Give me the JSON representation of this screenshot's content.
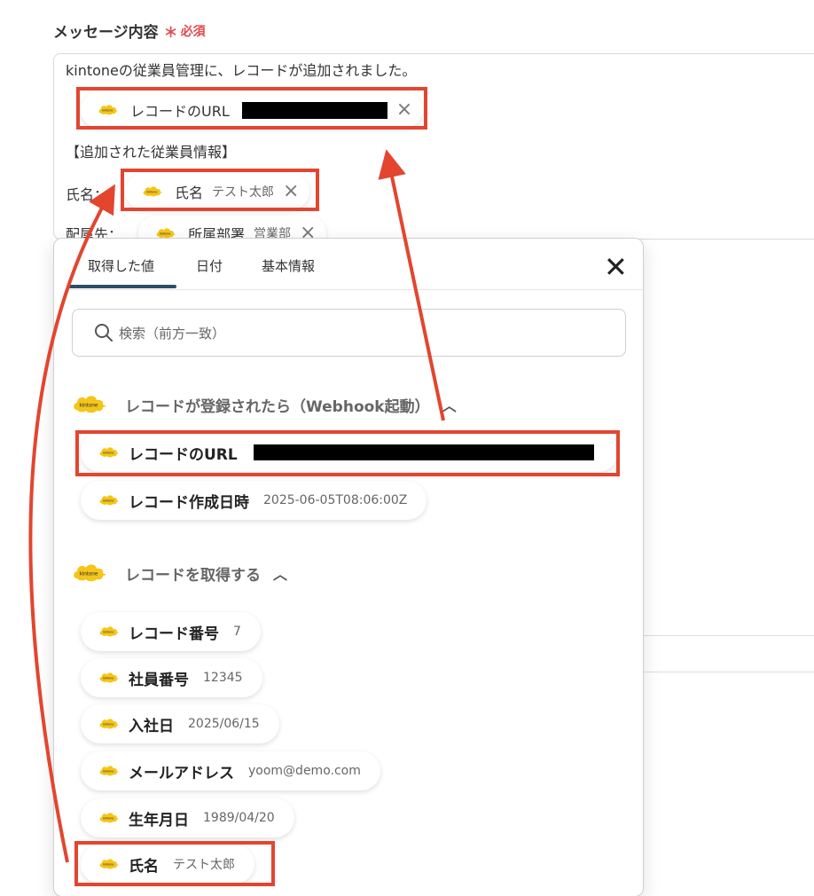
{
  "form": {
    "label": "メッセージ内容",
    "required_mark": "＊",
    "required_text": "必須"
  },
  "message": {
    "line1": "kintoneの従業員管理に、レコードが追加されました。",
    "token_url": {
      "label": "レコードのURL"
    },
    "line_section": "【追加された従業員情報】",
    "name_prefix": "氏名：",
    "token_name": {
      "label": "氏名",
      "value": "テスト太郎"
    },
    "dept_prefix": "配属先：",
    "token_dept": {
      "label": "所属部署",
      "value": "営業部"
    }
  },
  "picker": {
    "tabs": [
      "取得した値",
      "日付",
      "基本情報"
    ],
    "active_tab": 0,
    "search_placeholder": "検索（前方一致）",
    "sections": [
      {
        "title": "レコードが登録されたら（Webhook起動）",
        "items": [
          {
            "label": "レコードのURL",
            "value": ""
          },
          {
            "label": "レコード作成日時",
            "value": "2025-06-05T08:06:00Z"
          }
        ]
      },
      {
        "title": "レコードを取得する",
        "items": [
          {
            "label": "レコード番号",
            "value": "7"
          },
          {
            "label": "社員番号",
            "value": "12345"
          },
          {
            "label": "入社日",
            "value": "2025/06/15"
          },
          {
            "label": "メールアドレス",
            "value": "yoom@demo.com"
          },
          {
            "label": "生年月日",
            "value": "1989/04/20"
          },
          {
            "label": "氏名",
            "value": "テスト太郎"
          }
        ]
      }
    ]
  },
  "icons": {
    "kintone": "kintone-cloud-icon",
    "search": "search-icon",
    "close": "close-icon",
    "chevron": "chevron-up-icon"
  },
  "colors": {
    "highlight": "#e3452f",
    "kintone_yellow": "#f5c518",
    "active_tab": "#2e4d6b",
    "required": "#e3484d"
  }
}
